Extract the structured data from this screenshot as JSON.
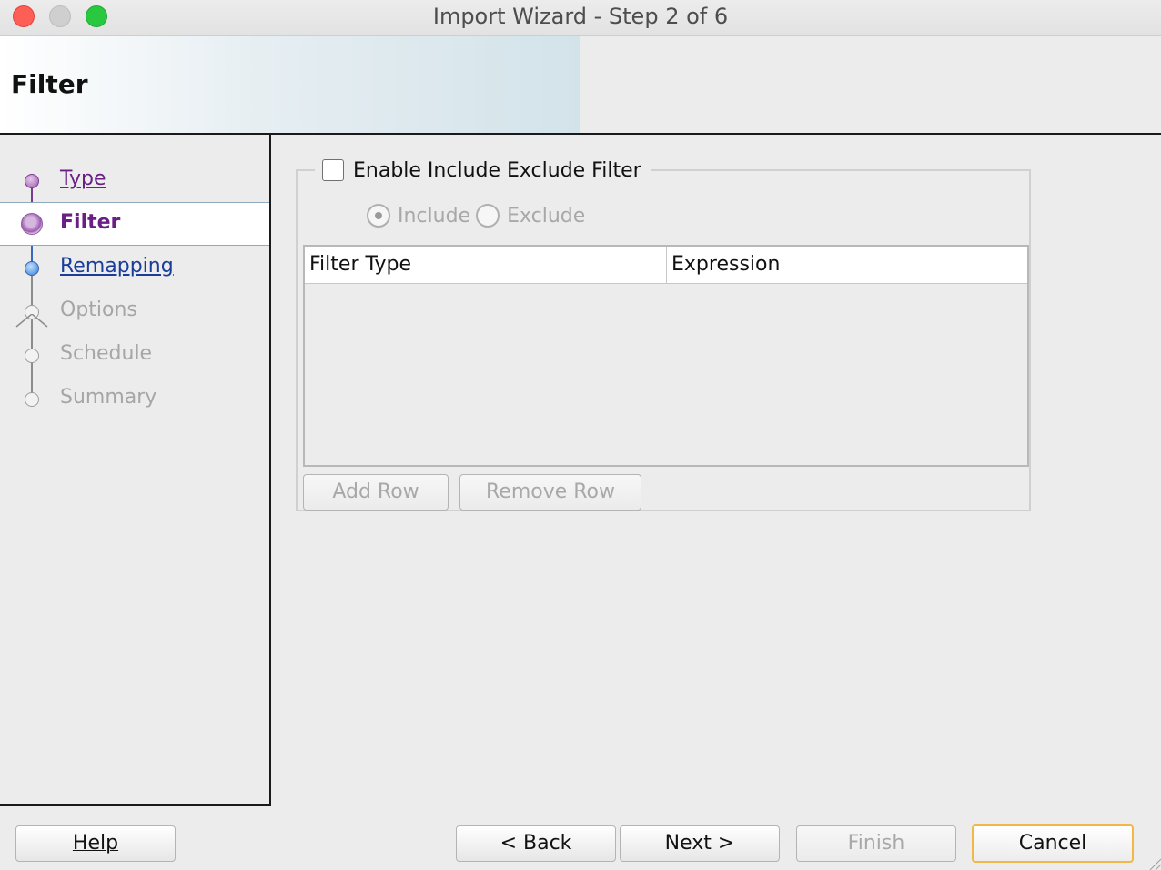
{
  "window": {
    "title": "Import Wizard - Step 2 of 6"
  },
  "header": {
    "title": "Filter"
  },
  "nav": {
    "items": [
      {
        "label": "Type",
        "state": "visited"
      },
      {
        "label": "Filter",
        "state": "current"
      },
      {
        "label": "Remapping",
        "state": "link"
      },
      {
        "label": "Options",
        "state": "disabled"
      },
      {
        "label": "Schedule",
        "state": "disabled"
      },
      {
        "label": "Summary",
        "state": "disabled"
      }
    ]
  },
  "filter": {
    "enable_label": "Enable Include Exclude Filter",
    "enable_checked": false,
    "include_label": "Include",
    "exclude_label": "Exclude",
    "selected_mode": "Include",
    "table": {
      "columns": [
        "Filter Type",
        "Expression"
      ],
      "rows": []
    },
    "add_row_label": "Add Row",
    "remove_row_label": "Remove Row"
  },
  "footer": {
    "help_label": "Help",
    "back_label": "< Back",
    "next_label": "Next >",
    "finish_label": "Finish",
    "cancel_label": "Cancel"
  },
  "colors": {
    "visited": "#6a1f85",
    "link": "#1a3d9a",
    "disabled": "#a6a6a6",
    "default_button_border": "#f3b748"
  }
}
